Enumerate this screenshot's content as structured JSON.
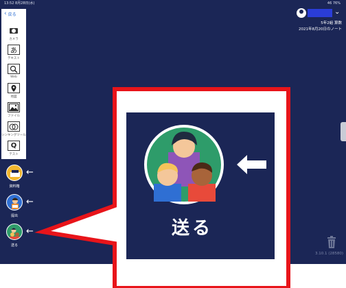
{
  "status_bar": {
    "time": "13:52 8月28日(水)",
    "right": "46 76%"
  },
  "toolbar": {
    "back_label": "戻る",
    "tools": [
      {
        "label": "カメラ",
        "icon": "camera-icon",
        "glyph": ""
      },
      {
        "label": "テキスト",
        "icon": "text-icon",
        "glyph": "あ"
      },
      {
        "label": "Web",
        "icon": "web-search-icon",
        "glyph": "🔍"
      },
      {
        "label": "地図",
        "icon": "map-icon",
        "glyph": "⌖"
      },
      {
        "label": "ファイル",
        "icon": "file-icon",
        "glyph": "🖼"
      },
      {
        "label": "シンキングツール",
        "icon": "thinking-tool-icon",
        "glyph": "◎"
      },
      {
        "label": "テスト",
        "icon": "test-icon",
        "glyph": "Q"
      }
    ]
  },
  "actions": [
    {
      "label": "資料箱",
      "icon": "material-box-icon",
      "color": "#f2b62e"
    },
    {
      "label": "提出",
      "icon": "submit-icon",
      "color": "#2f6fd3"
    },
    {
      "label": "送る",
      "icon": "send-icon",
      "color": "#2e9c6a"
    }
  ],
  "header": {
    "class_name": "5年2組 算数",
    "note_title": "2021年8月20日のノート"
  },
  "version": "3.10.1 (28580)",
  "callout": {
    "label": "送る",
    "border_color": "#e8141a"
  },
  "colors": {
    "background": "#1b2656",
    "accent_red": "#e8141a",
    "avatar_green": "#2e9c6a"
  }
}
